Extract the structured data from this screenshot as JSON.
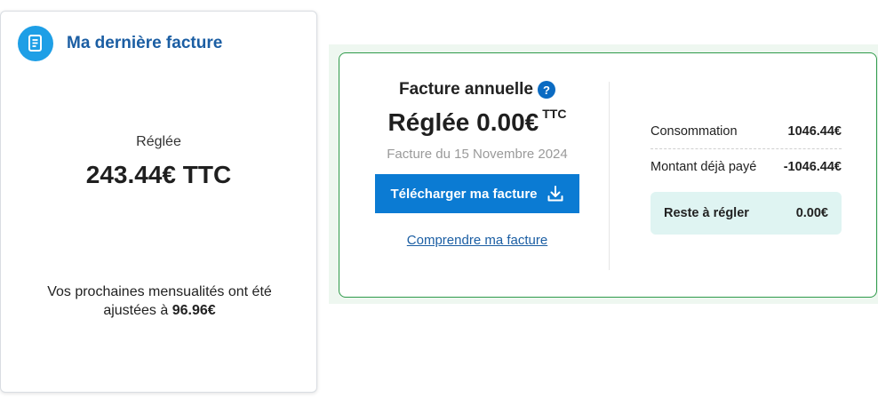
{
  "last_invoice": {
    "title": "Ma dernière facture",
    "status": "Réglée",
    "amount": "243.44€ TTC",
    "note_prefix": "Vos prochaines mensualités ont été ajustées à",
    "note_amount": "96.96€"
  },
  "annual": {
    "title": "Facture annuelle",
    "help_icon": "?",
    "paid_label": "Réglée 0.00€",
    "paid_suffix": "TTC",
    "date": "Facture du 15 Novembre 2024",
    "download_label": "Télécharger ma facture",
    "understand_label": "Comprendre ma facture"
  },
  "summary": {
    "consumption_label": "Consommation",
    "consumption_value": "1046.44€",
    "paid_label": "Montant déjà payé",
    "paid_value": "-1046.44€",
    "remaining_label": "Reste à régler",
    "remaining_value": "0.00€"
  },
  "icons": {
    "invoice": "document-icon",
    "help": "question-icon",
    "download": "download-icon"
  },
  "colors": {
    "brand_blue": "#1b5ea3",
    "button_blue": "#0b7bd3",
    "badge_blue": "#1e9fe6",
    "green_border": "#2e9a4a",
    "remaining_bg": "#dff4f2"
  }
}
